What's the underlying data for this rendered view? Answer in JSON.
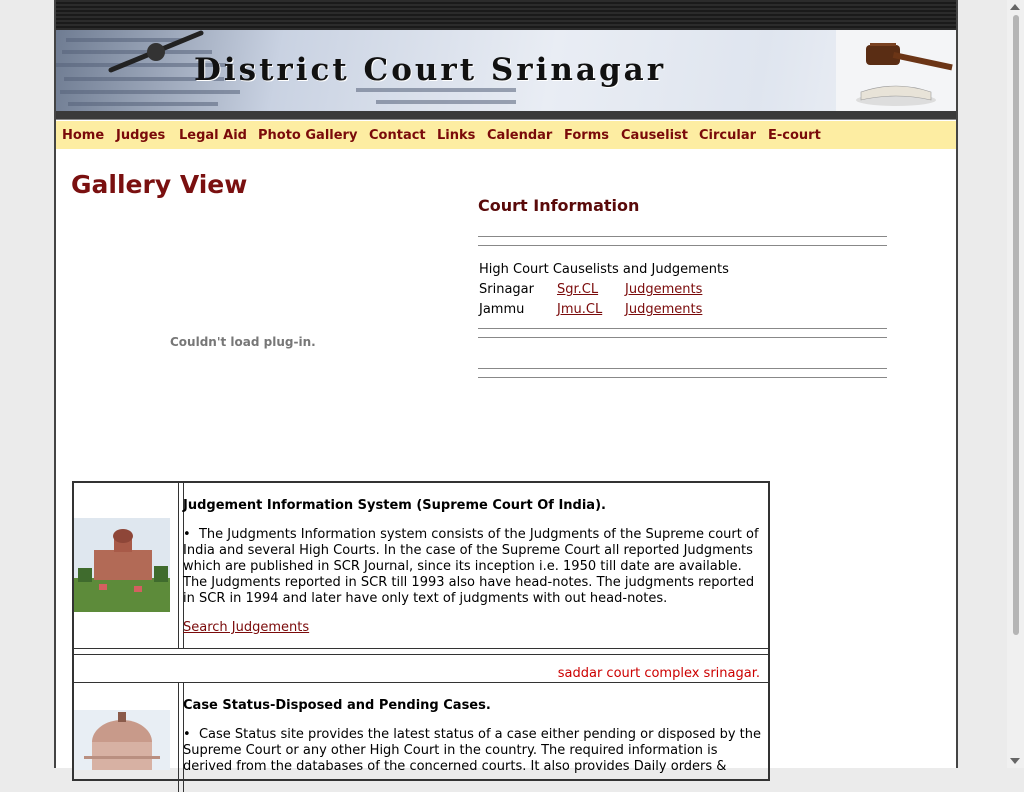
{
  "header": {
    "title": "District Court Srinagar"
  },
  "nav": {
    "items": [
      "Home",
      "Judges",
      "Legal Aid",
      "Photo Gallery",
      "Contact",
      "Links",
      "Calendar",
      "Forms",
      "Causelist",
      "Circular",
      "E-court"
    ]
  },
  "gallery": {
    "title": "Gallery View",
    "plugin_message": "Couldn't load plug-in."
  },
  "court_info": {
    "title": "Court Information",
    "hc_header": "High Court Causelists and Judgements",
    "rows": [
      {
        "city": "Srinagar",
        "causelist": "Sgr.CL",
        "judgements": "Judgements"
      },
      {
        "city": "Jammu",
        "causelist": "Jmu.CL",
        "judgements": "Judgements"
      }
    ]
  },
  "entries": [
    {
      "title": "Judgement Information System (Supreme Court Of India).",
      "bullet": "•",
      "text": "The Judgments Information system consists of the Judgments of the Supreme court of India and several High Courts. In the case of the Supreme Court all reported Judgments which are published in SCR Journal, since its inception i.e. 1950 till date are available. The Judgments reported in SCR till 1993 also have head-notes. The judgments reported in SCR in 1994 and later have only text of judgments with out head-notes.",
      "link": "Search Judgements"
    },
    {
      "caption": "saddar court complex srinagar."
    },
    {
      "title": "Case Status-Disposed and Pending Cases.",
      "bullet": "•",
      "text": "Case Status site provides the latest status of a case either pending or disposed by the Supreme Court or any other High Court in the country. The required information is derived from the databases of the concerned courts. It also provides Daily orders &"
    }
  ],
  "colors": {
    "nav_bg": "#fdeda2",
    "link": "#7a0a0a",
    "title": "#7a1010",
    "caption": "#cc0000"
  }
}
